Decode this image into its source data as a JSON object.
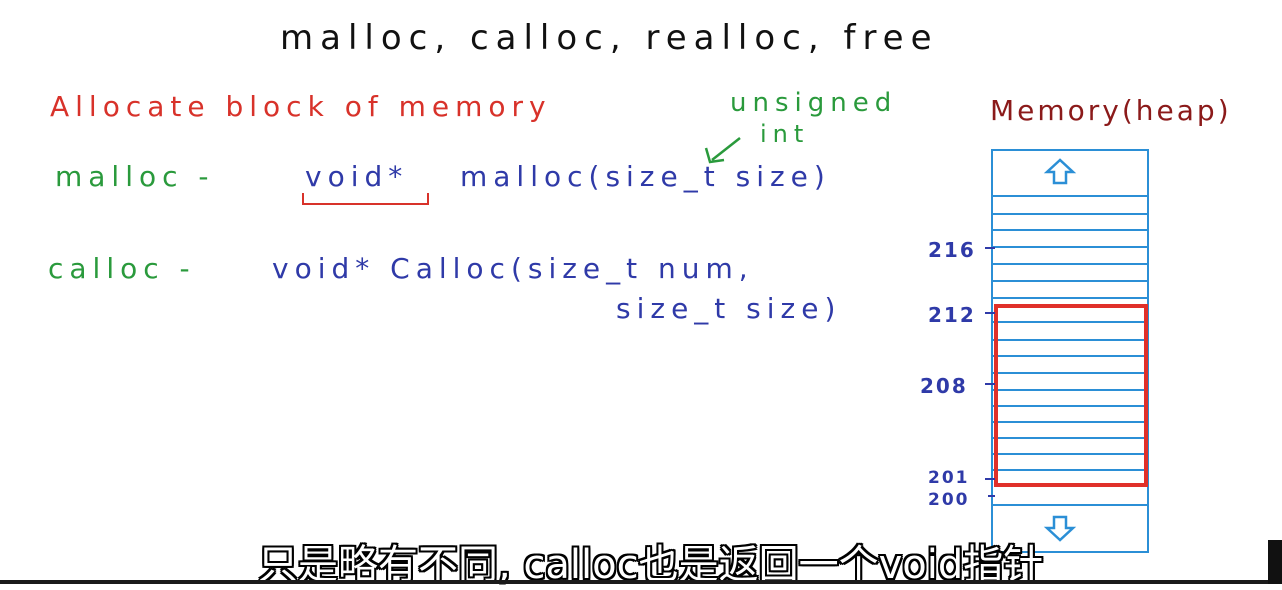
{
  "title": "malloc, calloc, realloc, free",
  "allocate_heading": "Allocate block of memory",
  "annotation": {
    "line1": "unsigned",
    "line2": "int"
  },
  "malloc": {
    "label": "malloc -",
    "return_type": "void*",
    "signature": "malloc(size_t size)"
  },
  "calloc": {
    "label": "calloc -",
    "signature": "void* Calloc(size_t num,",
    "signature_cont": "size_t size)"
  },
  "heap_label": "Memory(heap)",
  "addresses": {
    "a216": "216",
    "a212": "212",
    "a208": "208",
    "a201": "201",
    "a200": "200"
  },
  "subtitle": "只是略有不同, calloc也是返回一个void指针",
  "colors": {
    "red": "#d8322a",
    "green": "#2a9a3c",
    "blue": "#2f3aa8",
    "heap_border": "#2b8fd6",
    "highlight": "#e0302a",
    "maroon": "#8b1a1a"
  },
  "icons": [
    "arrow-up-icon",
    "arrow-down-icon",
    "pointer-arrow-icon"
  ]
}
